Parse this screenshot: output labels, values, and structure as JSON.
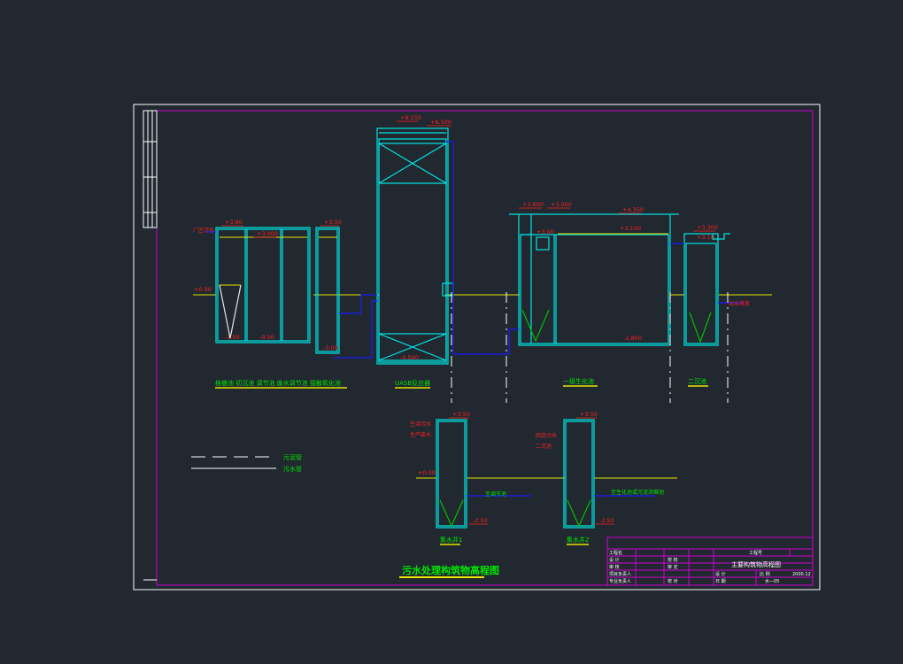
{
  "drawing": {
    "title": "污水处理构筑物高程图",
    "colors": {
      "background": "#212830",
      "sheet_border": "#ffffff",
      "inner_border": "#d400d4",
      "structure": "#00e5e5",
      "pipe": "#1a1aff",
      "water_level": "#e6e600",
      "label": "#00e600",
      "elevation": "#ff2020",
      "axis": "#ffffff"
    },
    "units": [
      {
        "id": "grit",
        "caption": "格栅池  初沉池  调节池  废水调节池  接触氧化池"
      },
      {
        "id": "uasb",
        "caption": "UASB反应器"
      },
      {
        "id": "bio",
        "caption": "一级生化池"
      },
      {
        "id": "sed2",
        "caption": "二沉池"
      },
      {
        "id": "sump1",
        "caption": "集水井1"
      },
      {
        "id": "sump2",
        "caption": "集水井2"
      }
    ],
    "elevations": [
      {
        "id": "e1",
        "text": "+3.80"
      },
      {
        "id": "e2",
        "text": "+3.000"
      },
      {
        "id": "e3",
        "text": "+3.50"
      },
      {
        "id": "e4",
        "text": "+0.00"
      },
      {
        "id": "e5",
        "text": "-1.50"
      },
      {
        "id": "e6",
        "text": "-0.50"
      },
      {
        "id": "e7",
        "text": "-3.00"
      },
      {
        "id": "e8",
        "text": "+8.150"
      },
      {
        "id": "e9",
        "text": "+8.500"
      },
      {
        "id": "e10",
        "text": "-0.500"
      },
      {
        "id": "e11",
        "text": "+3.600"
      },
      {
        "id": "e12",
        "text": "+3.000"
      },
      {
        "id": "e13",
        "text": "+4.350"
      },
      {
        "id": "e14",
        "text": "+3.100"
      },
      {
        "id": "e15",
        "text": "+3.00"
      },
      {
        "id": "e16",
        "text": "-2.800"
      },
      {
        "id": "e17",
        "text": "+3.300"
      },
      {
        "id": "e18",
        "text": "+3.10"
      },
      {
        "id": "e19",
        "text": "+3.50"
      },
      {
        "id": "e20",
        "text": "+0.00"
      },
      {
        "id": "e21",
        "text": "-2.50"
      },
      {
        "id": "e22",
        "text": "+3.50"
      },
      {
        "id": "e23",
        "text": "-2.50"
      }
    ],
    "notes": [
      {
        "id": "n1",
        "text": "厂区污水"
      },
      {
        "id": "n2",
        "text": "出水排放"
      },
      {
        "id": "n3",
        "text": "生活污水"
      },
      {
        "id": "n4",
        "text": "生产废水"
      },
      {
        "id": "n5",
        "text": "至调节池"
      },
      {
        "id": "n6",
        "text": "回流污水"
      },
      {
        "id": "n7",
        "text": "二沉池"
      },
      {
        "id": "n8",
        "text": "至生化池或污泥浓缩池"
      }
    ],
    "legend": [
      {
        "id": "l1",
        "text": "污泥管"
      },
      {
        "id": "l2",
        "text": "污水管"
      }
    ],
    "title_block": {
      "project": "主要构筑物高程图",
      "rows_left": [
        "工程名",
        "设 计",
        "审 核",
        "项目负责人",
        "专业负责人"
      ],
      "rows_mid": [
        "",
        "校 核",
        "审 定",
        "",
        "校 对"
      ],
      "drawing_no_label": "工程号",
      "scale_label": "比 例",
      "date_label": "日 期",
      "date": "2000.12",
      "sheet_label": "图 号",
      "sheet": "水—05",
      "stage": "设 计"
    }
  }
}
